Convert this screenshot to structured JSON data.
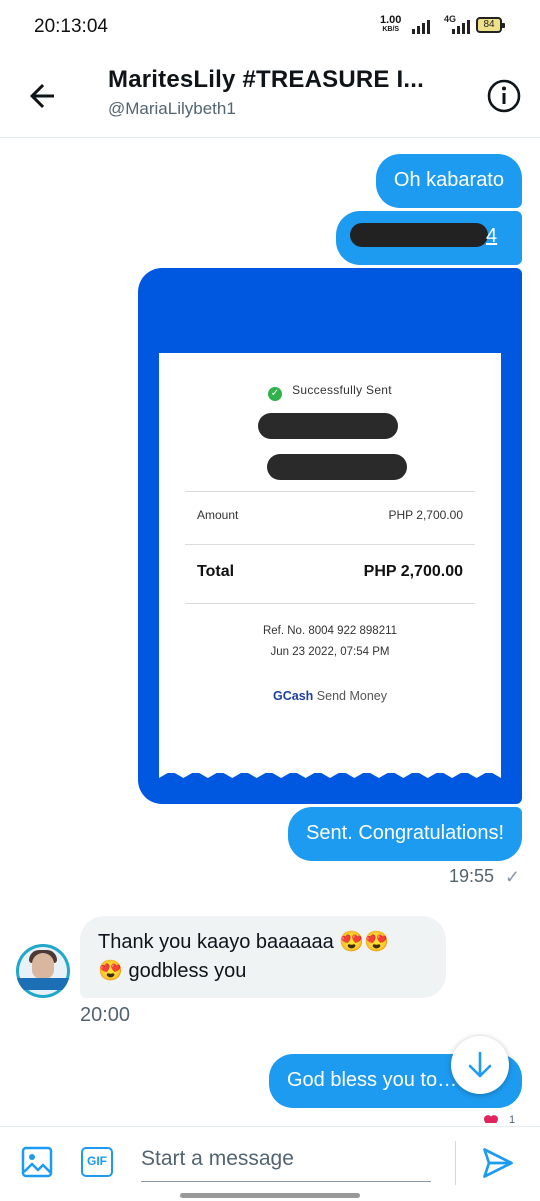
{
  "status_bar": {
    "time": "20:13:04",
    "net_rate": "1.00",
    "net_rate_unit": "KB/S",
    "network": "4G",
    "battery": "84"
  },
  "header": {
    "title": "MaritesLily #TREASURE I...",
    "handle": "@MariaLilybeth1",
    "back_icon": "arrow-left-icon",
    "info_icon": "info-icon"
  },
  "messages": [
    {
      "dir": "out",
      "text": "Oh kabarato"
    },
    {
      "dir": "out",
      "text": "4",
      "redacted": true
    },
    {
      "dir": "out",
      "type": "image",
      "alt": "GCash receipt"
    },
    {
      "dir": "out",
      "text": "Sent. Congratulations!",
      "time": "19:55"
    },
    {
      "dir": "in",
      "text": "Thank you kaayo baaaaaa 😍😍\n😍 godbless you",
      "time": "20:00"
    },
    {
      "dir": "out",
      "text": "God bless you to…",
      "reaction": "❤️",
      "reaction_count": "1"
    }
  ],
  "receipt": {
    "status": "Successfully Sent",
    "amount_label": "Amount",
    "amount_value": "PHP 2,700.00",
    "total_label": "Total",
    "total_value": "PHP 2,700.00",
    "ref": "Ref. No. 8004 922 898211",
    "date": "Jun 23 2022, 07:54 PM",
    "brand": "GCash",
    "service": "Send Money"
  },
  "composer": {
    "placeholder": "Start a message",
    "gif_label": "GIF"
  },
  "colors": {
    "accent": "#1d9bf0",
    "receipt_bg": "#0058e0"
  }
}
